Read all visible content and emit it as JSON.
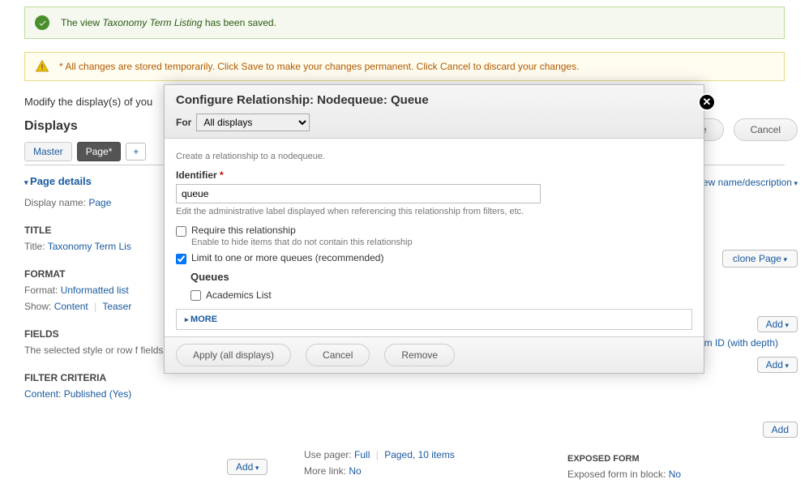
{
  "status_message_prefix": "The view ",
  "status_message_view": "Taxonomy Term Listing",
  "status_message_suffix": " has been saved.",
  "warning_prefix": "*",
  "warning_message": "All changes are stored temporarily. Click Save to make your changes permanent. Click Cancel to discard your changes.",
  "modify_text": "Modify the display(s) of you",
  "save_label": "Save",
  "cancel_label": "Cancel",
  "displays_header": "Displays",
  "tabs": {
    "master": "Master",
    "page": "Page*",
    "add": "+"
  },
  "edit_view_link": "view name/description",
  "page_details": {
    "header": "Page details",
    "display_name_lbl": "Display name:",
    "display_name_val": "Page",
    "clone_label": "clone Page"
  },
  "title": {
    "header": "TITLE",
    "lbl": "Title:",
    "val": "Taxonomy Term Lis"
  },
  "format": {
    "header": "FORMAT",
    "format_lbl": "Format:",
    "format_val": "Unformatted list",
    "show_lbl": "Show:",
    "show_val1": "Content",
    "show_val2": "Teaser"
  },
  "fields": {
    "header": "FIELDS",
    "desc": "The selected style or row f fields."
  },
  "filter": {
    "header": "FILTER CRITERIA",
    "item": "Content: Published (Yes)",
    "add": "Add"
  },
  "pager": {
    "use_pager_lbl": "Use pager:",
    "use_pager_val1": "Full",
    "use_pager_val2": "Paged, 10 items",
    "more_link_lbl": "More link:",
    "more_link_val": "No"
  },
  "exposed": {
    "header": "EXPOSED FORM",
    "lbl": "Exposed form in block:",
    "val": "No"
  },
  "term_id_link": "term ID (with depth)",
  "add_label": "Add",
  "modal": {
    "title": "Configure Relationship: Nodequeue: Queue",
    "for_lbl": "For",
    "for_val": "All displays",
    "hint": "Create a relationship to a nodequeue.",
    "identifier_lbl": "Identifier",
    "identifier_val": "queue",
    "identifier_desc": "Edit the administrative label displayed when referencing this relationship from filters, etc.",
    "require_lbl": "Require this relationship",
    "require_desc": "Enable to hide items that do not contain this relationship",
    "limit_lbl": "Limit to one or more queues (recommended)",
    "queues_header": "Queues",
    "queue_option": "Academics List",
    "more_label": "MORE",
    "apply_label": "Apply (all displays)",
    "cancel_label": "Cancel",
    "remove_label": "Remove"
  }
}
